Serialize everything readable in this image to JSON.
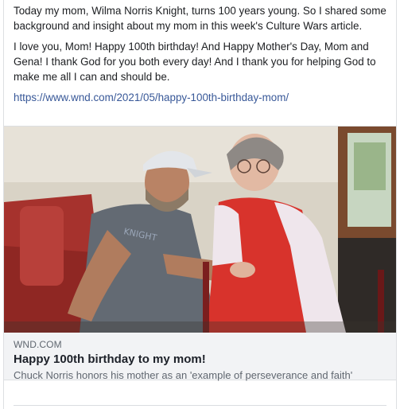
{
  "post": {
    "paragraph_1": "Today my mom, Wilma Norris Knight, turns 100 years young. So I shared some background and insight about my mom in this week's Culture Wars article.",
    "paragraph_2": "I love you, Mom! Happy 100th birthday! And Happy Mother's Day, Mom and Gena! I thank God for you both every day! And I thank you for helping God to make me all I can and should be.",
    "link": "https://www.wnd.com/2021/05/happy-100th-birthday-mom/"
  },
  "link_card": {
    "domain": "WND.COM",
    "title": "Happy 100th birthday to my mom!",
    "description": "Chuck Norris honors his mother as an 'example of perseverance and faith'"
  },
  "colors": {
    "link": "#385898",
    "card_background": "#f2f3f5",
    "muted_text": "#606770"
  }
}
